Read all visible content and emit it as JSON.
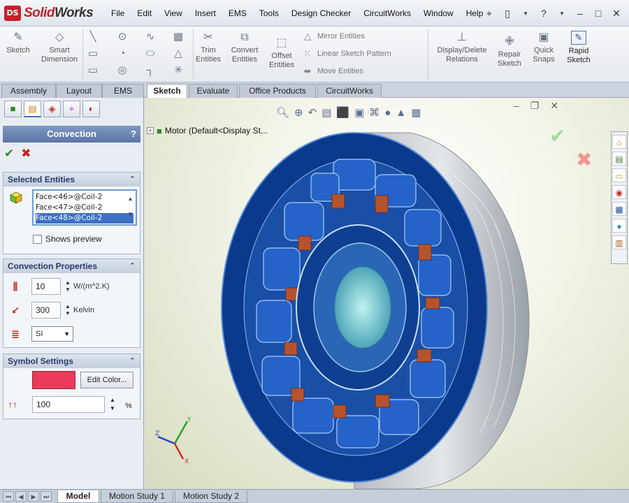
{
  "app": {
    "brand_solid": "Solid",
    "brand_works": "Works",
    "logo_mark": "DS"
  },
  "menus": [
    "File",
    "Edit",
    "View",
    "Insert",
    "EMS",
    "Tools",
    "Design Checker",
    "CircuitWorks",
    "Window",
    "Help"
  ],
  "toolbar": {
    "sketch": [
      "Sketch"
    ],
    "smart_dimension": [
      "Smart",
      "Dimension"
    ],
    "trim": [
      "Trim",
      "Entities"
    ],
    "convert": [
      "Convert",
      "Entities"
    ],
    "offset": [
      "Offset",
      "Entities"
    ],
    "mirror": "Mirror Entities",
    "linear_pattern": "Linear Sketch Pattern",
    "move": "Move Entities",
    "display_delete": [
      "Display/Delete",
      "Relations"
    ],
    "repair": [
      "Repair",
      "Sketch"
    ],
    "quick_snaps": [
      "Quick",
      "Snaps"
    ],
    "rapid_sketch": [
      "Rapid",
      "Sketch"
    ]
  },
  "command_tabs": [
    "Sketch",
    "Evaluate",
    "Office Products",
    "CircuitWorks"
  ],
  "left_tabs": [
    "Assembly",
    "Layout",
    "EMS"
  ],
  "property_manager": {
    "title": "Convection",
    "help": "?",
    "selected_entities": {
      "header": "Selected Entities",
      "items": [
        "Face<46>@Coil-2",
        "Face<47>@Coil-2",
        "Face<48>@Coil-2"
      ],
      "selected_index": 2,
      "shows_preview": "Shows preview"
    },
    "convection_properties": {
      "header": "Convection Properties",
      "coefficient": "10",
      "coefficient_unit": "W/(m^2.K)",
      "temperature": "300",
      "temperature_unit": "Kelvin",
      "unit_system": "SI"
    },
    "symbol_settings": {
      "header": "Symbol Settings",
      "color": "#ea3b5a",
      "edit_color": "Edit Color...",
      "size": "100",
      "size_unit": "%"
    }
  },
  "viewport": {
    "tree_root": "Motor  (Default<Display St..."
  },
  "bottom_tabs": [
    "Model",
    "Motion Study 1",
    "Motion Study 2"
  ]
}
